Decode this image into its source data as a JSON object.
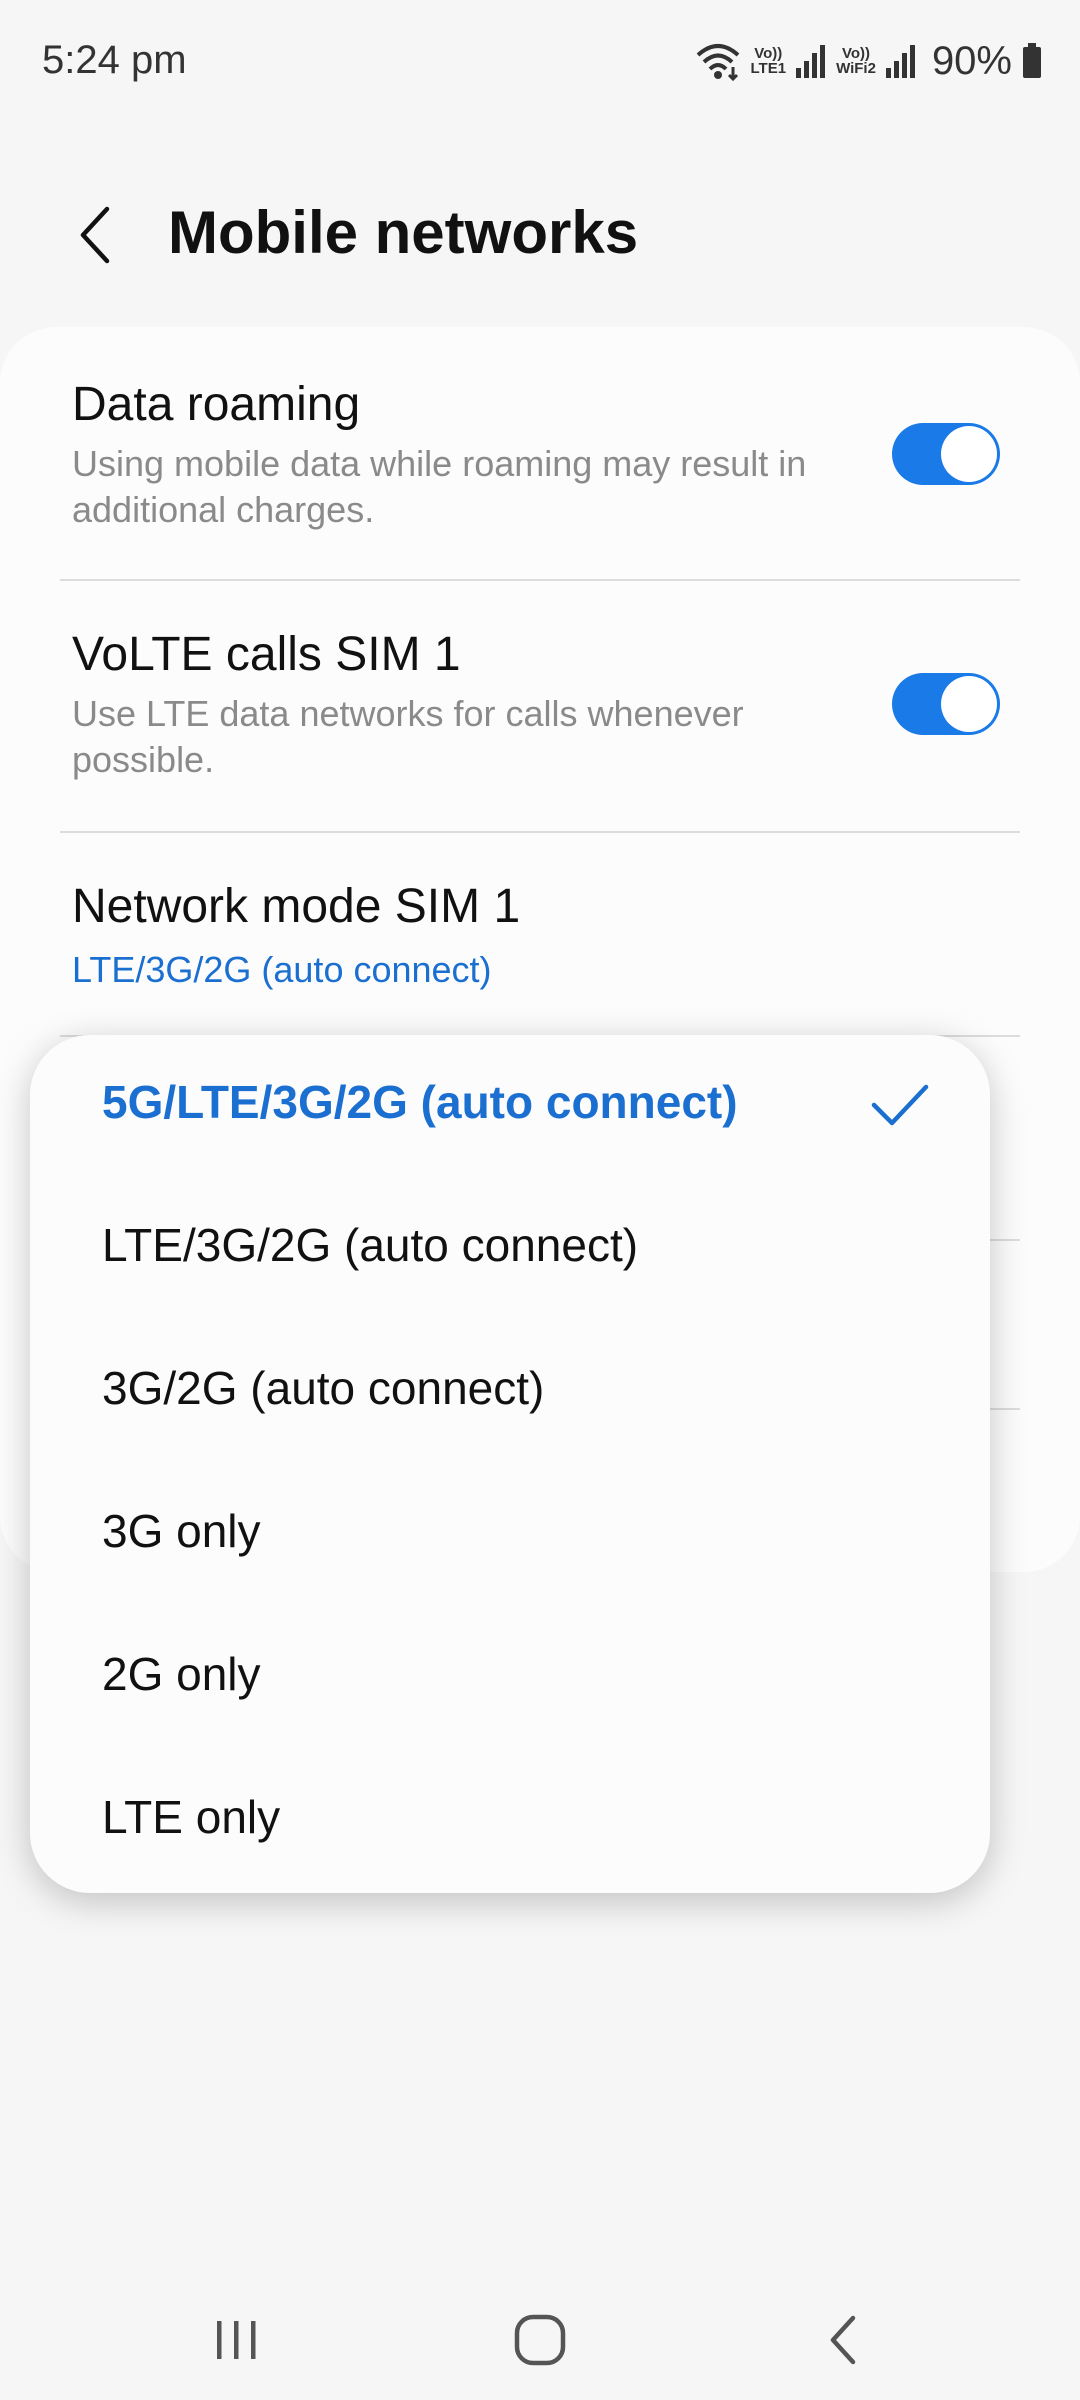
{
  "status_bar": {
    "time": "5:24 pm",
    "volte1_top": "Vo))",
    "volte1_bottom": "LTE1",
    "volte2_top": "Vo))",
    "volte2_bottom": "WiFi2",
    "battery_text": "90%"
  },
  "header": {
    "title": "Mobile networks"
  },
  "settings": {
    "data_roaming": {
      "title": "Data roaming",
      "description": "Using mobile data while roaming may result in additional charges.",
      "enabled": true
    },
    "volte_sim1": {
      "title": "VoLTE calls SIM 1",
      "description": "Use LTE data networks for calls whenever possible.",
      "enabled": true
    },
    "network_mode_sim1": {
      "title": "Network mode SIM 1",
      "value": "LTE/3G/2G (auto connect)"
    }
  },
  "dropdown": {
    "options": [
      {
        "label": "5G/LTE/3G/2G (auto connect)",
        "selected": true
      },
      {
        "label": "LTE/3G/2G (auto connect)",
        "selected": false
      },
      {
        "label": "3G/2G (auto connect)",
        "selected": false
      },
      {
        "label": "3G only",
        "selected": false
      },
      {
        "label": "2G only",
        "selected": false
      },
      {
        "label": "LTE only",
        "selected": false
      }
    ]
  },
  "colors": {
    "accent": "#1a7ae8",
    "accent_text": "#1a6fd0",
    "background": "#f6f6f6",
    "card": "#fcfcfc"
  }
}
